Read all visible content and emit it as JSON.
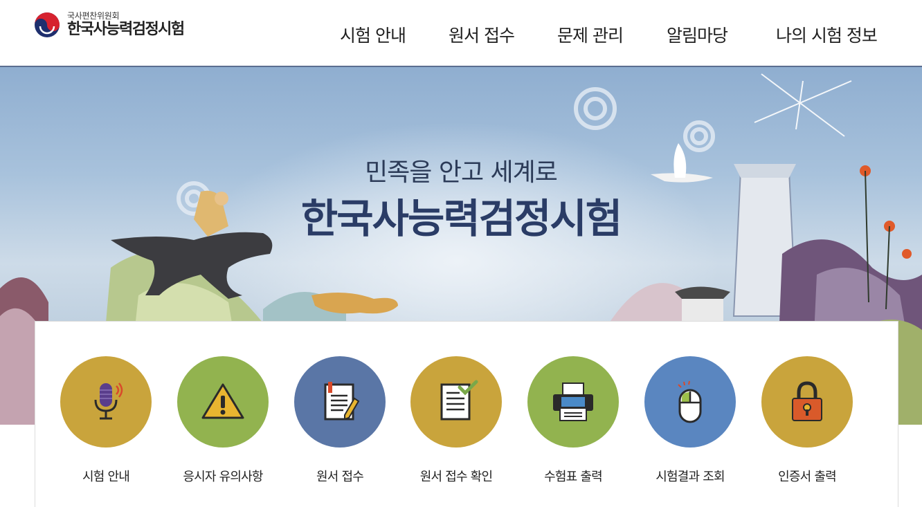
{
  "header": {
    "org": "국사편찬위원회",
    "title": "한국사능력검정시험"
  },
  "nav": [
    {
      "label": "시험 안내"
    },
    {
      "label": "원서 접수"
    },
    {
      "label": "문제 관리"
    },
    {
      "label": "알림마당"
    },
    {
      "label": "나의 시험 정보"
    }
  ],
  "banner": {
    "tagline": "민족을 안고 세계로",
    "title": "한국사능력검정시험"
  },
  "quick_menu": [
    {
      "label": "시험 안내",
      "icon": "microphone-icon",
      "color": "#c9a43c"
    },
    {
      "label": "응시자 유의사항",
      "icon": "warning-icon",
      "color": "#92b34f"
    },
    {
      "label": "원서 접수",
      "icon": "notebook-icon",
      "color": "#5a76a6"
    },
    {
      "label": "원서 접수 확인",
      "icon": "document-check-icon",
      "color": "#c9a43c"
    },
    {
      "label": "수험표 출력",
      "icon": "printer-icon",
      "color": "#92b34f"
    },
    {
      "label": "시험결과 조회",
      "icon": "mouse-icon",
      "color": "#5a86c0"
    },
    {
      "label": "인증서 출력",
      "icon": "lock-icon",
      "color": "#c9a43c"
    }
  ],
  "colors": {
    "header_border": "#5a6e90",
    "banner_title": "#2a3c66"
  }
}
